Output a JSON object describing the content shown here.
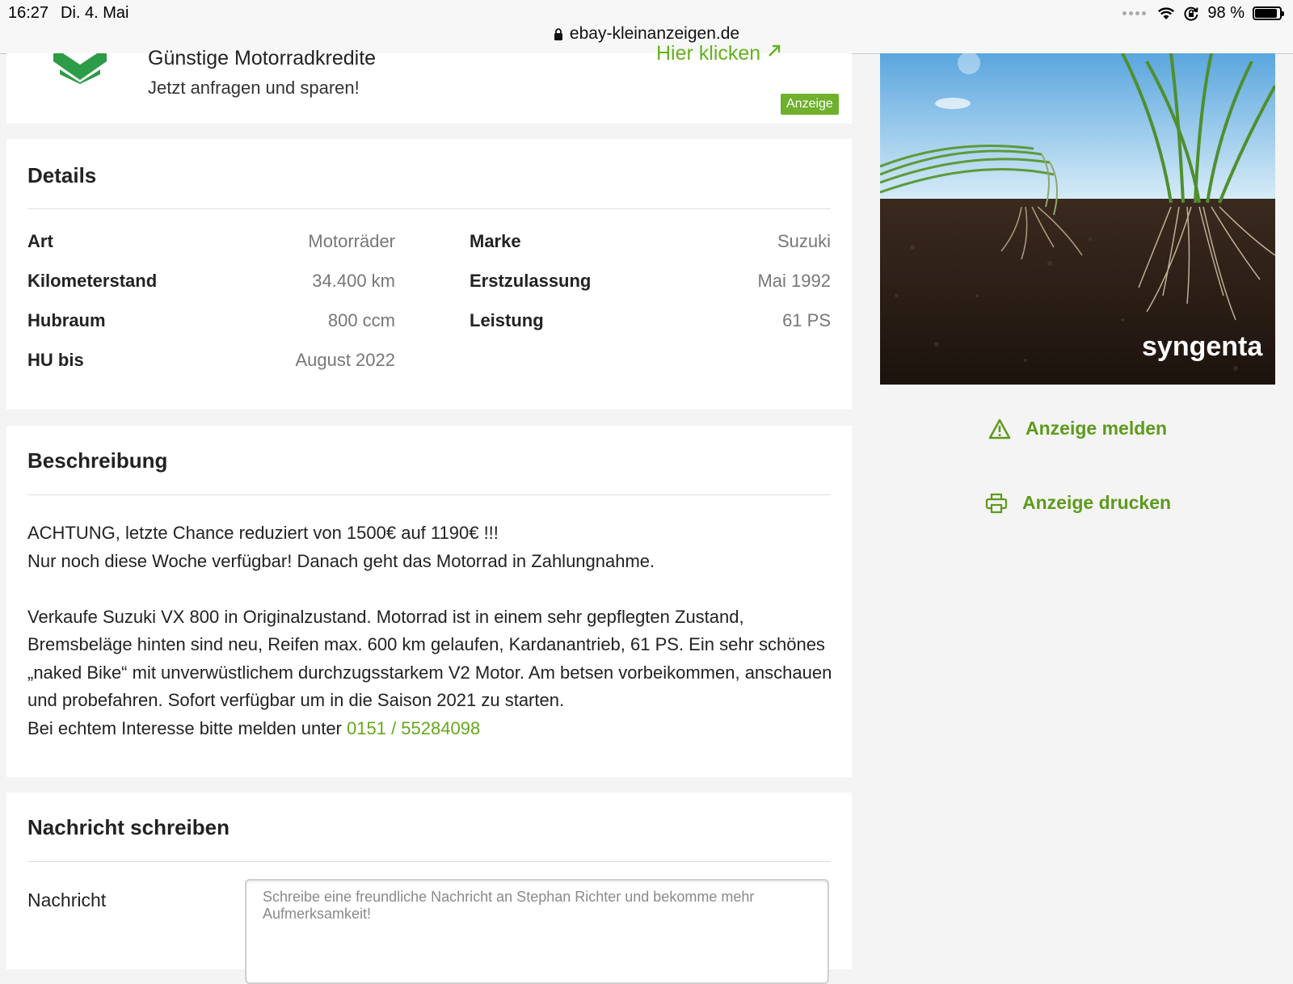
{
  "statusbar": {
    "time": "16:27",
    "date": "Di. 4. Mai",
    "battery": "98 %",
    "battery_level": 0.98
  },
  "browser": {
    "url": "ebay-kleinanzeigen.de"
  },
  "ad_banner": {
    "title": "Günstige Motorradkredite",
    "subtitle": "Jetzt anfragen und sparen!",
    "link": "Hier klicken",
    "badge": "Anzeige"
  },
  "details": {
    "title": "Details",
    "rows": [
      {
        "label": "Art",
        "value": "Motorräder"
      },
      {
        "label": "Marke",
        "value": "Suzuki"
      },
      {
        "label": "Kilometerstand",
        "value": "34.400 km"
      },
      {
        "label": "Erstzulassung",
        "value": "Mai 1992"
      },
      {
        "label": "Hubraum",
        "value": "800 ccm"
      },
      {
        "label": "Leistung",
        "value": "61 PS"
      },
      {
        "label": "HU bis",
        "value": "August 2022"
      }
    ]
  },
  "description": {
    "title": "Beschreibung",
    "line1": "ACHTUNG, letzte Chance reduziert von 1500€ auf 1190€ !!!",
    "line2": "Nur noch diese Woche verfügbar! Danach geht das Motorrad in Zahlungnahme.",
    "para": "Verkaufe Suzuki VX 800 in Originalzustand. Motorrad ist in einem sehr gepflegten Zustand, Bremsbeläge hinten sind neu, Reifen max. 600 km gelaufen, Kardanantrieb, 61 PS. Ein sehr schönes „naked Bike“ mit unverwüstlichem durchzugsstarkem V2 Motor. Am betsen vorbeikommen, anschauen und probefahren. Sofort verfügbar um in die Saison 2021 zu starten.",
    "contact_prefix": "Bei echtem Interesse bitte melden unter",
    "phone": "0151 / 55284098"
  },
  "message": {
    "title": "Nachricht schreiben",
    "label": "Nachricht",
    "placeholder": "Schreibe eine freundliche Nachricht an Stephan Richter und bekomme mehr Aufmerksamkeit!"
  },
  "sidebar": {
    "ad_brand": "syngenta",
    "report": "Anzeige melden",
    "print": "Anzeige drucken"
  },
  "colors": {
    "accent": "#66b11f",
    "badge": "#6fb02c",
    "link": "#5d9a1c"
  }
}
